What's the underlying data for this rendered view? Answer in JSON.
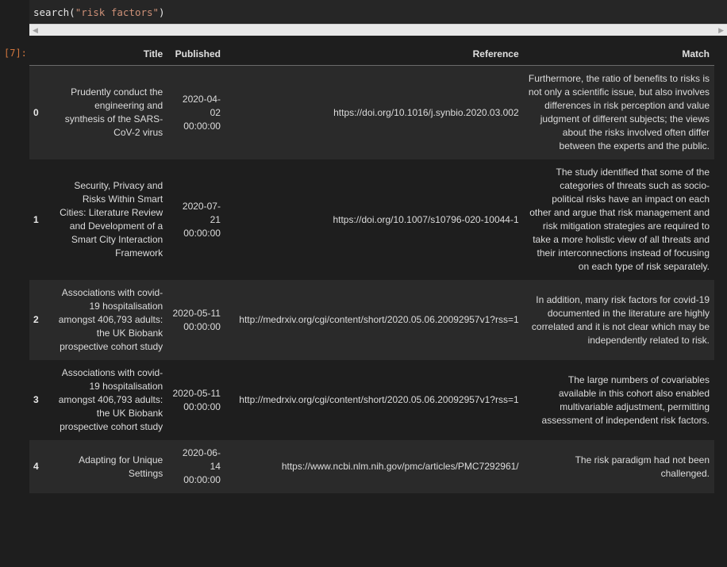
{
  "input": {
    "fn": "search(",
    "arg": "\"risk factors\"",
    "close": ")"
  },
  "output": {
    "prompt": "[7]:",
    "columns": {
      "title": "Title",
      "published": "Published",
      "reference": "Reference",
      "match": "Match"
    },
    "rows": [
      {
        "index": "0",
        "title": "Prudently conduct the engineering and synthesis of the SARS-CoV-2 virus",
        "published": "2020-04-02 00:00:00",
        "reference": "https://doi.org/10.1016/j.synbio.2020.03.002",
        "match": "Furthermore, the ratio of benefits to risks is not only a scientific issue, but also involves differences in risk perception and value judgment of different subjects; the views about the risks involved often differ between the experts and the public."
      },
      {
        "index": "1",
        "title": "Security, Privacy and Risks Within Smart Cities: Literature Review and Development of a Smart City Interaction Framework",
        "published": "2020-07-21 00:00:00",
        "reference": "https://doi.org/10.1007/s10796-020-10044-1",
        "match": "The study identified that some of the categories of threats such as socio-political risks have an impact on each other and argue that risk management and risk mitigation strategies are required to take a more holistic view of all threats and their interconnections instead of focusing on each type of risk separately."
      },
      {
        "index": "2",
        "title": "Associations with covid-19 hospitalisation amongst 406,793 adults: the UK Biobank prospective cohort study",
        "published": "2020-05-11 00:00:00",
        "reference": "http://medrxiv.org/cgi/content/short/2020.05.06.20092957v1?rss=1",
        "match": "In addition, many risk factors for covid-19 documented in the literature are highly correlated and it is not clear which may be independently related to risk."
      },
      {
        "index": "3",
        "title": "Associations with covid-19 hospitalisation amongst 406,793 adults: the UK Biobank prospective cohort study",
        "published": "2020-05-11 00:00:00",
        "reference": "http://medrxiv.org/cgi/content/short/2020.05.06.20092957v1?rss=1",
        "match": "The large numbers of covariables available in this cohort also enabled multivariable adjustment, permitting assessment of independent risk factors."
      },
      {
        "index": "4",
        "title": "Adapting for Unique Settings",
        "published": "2020-06-14 00:00:00",
        "reference": "https://www.ncbi.nlm.nih.gov/pmc/articles/PMC7292961/",
        "match": "The risk paradigm had not been challenged."
      }
    ]
  }
}
